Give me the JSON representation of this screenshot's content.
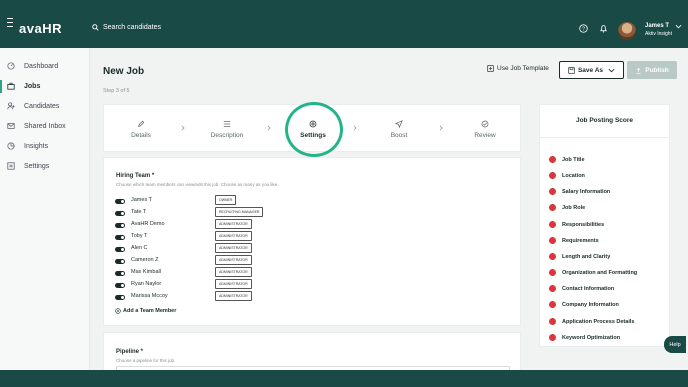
{
  "app": {
    "logo": "avaHR",
    "search_placeholder": "Search candidates",
    "user_name": "James T",
    "user_company": "Aktiv Insight",
    "help_label": "Help"
  },
  "sidebar": {
    "items": [
      {
        "label": "Dashboard",
        "icon": "dashboard-icon"
      },
      {
        "label": "Jobs",
        "icon": "briefcase-icon",
        "active": true
      },
      {
        "label": "Candidates",
        "icon": "users-icon"
      },
      {
        "label": "Shared Inbox",
        "icon": "inbox-icon"
      },
      {
        "label": "Insights",
        "icon": "insights-icon"
      },
      {
        "label": "Settings",
        "icon": "settings-icon"
      }
    ]
  },
  "header": {
    "title": "New Job",
    "step_label": "Step 3 of 5",
    "use_template_label": "Use Job Template",
    "save_as_label": "Save As",
    "publish_label": "Publish"
  },
  "steps": [
    {
      "label": "Details",
      "icon": "pencil-icon"
    },
    {
      "label": "Description",
      "icon": "list-icon"
    },
    {
      "label": "Settings",
      "icon": "gear-icon",
      "active": true
    },
    {
      "label": "Boost",
      "icon": "rocket-icon"
    },
    {
      "label": "Review",
      "icon": "check-circle-icon"
    }
  ],
  "hiring_team": {
    "title": "Hiring Team *",
    "subtitle": "Choose which team members can view/edit this job. Choose as many as you like.",
    "members": [
      {
        "name": "James T",
        "role": "OWNER",
        "enabled": true
      },
      {
        "name": "Tate T",
        "role": "RECRUITING MANAGER",
        "enabled": true
      },
      {
        "name": "AvaHR Demo",
        "role": "ADMINISTRATOR",
        "enabled": true
      },
      {
        "name": "Toby T",
        "role": "ADMINISTRATOR",
        "enabled": true
      },
      {
        "name": "Alen C",
        "role": "ADMINISTRATOR",
        "enabled": true
      },
      {
        "name": "Cameron Z",
        "role": "ADMINISTRATOR",
        "enabled": true
      },
      {
        "name": "Max Kimball",
        "role": "ADMINISTRATOR",
        "enabled": true
      },
      {
        "name": "Ryan Naylor",
        "role": "ADMINISTRATOR",
        "enabled": true
      },
      {
        "name": "Marissa Mccoy",
        "role": "ADMINISTRATOR",
        "enabled": true
      }
    ],
    "add_member_label": "Add a Team Member"
  },
  "pipeline": {
    "title": "Pipeline *",
    "subtitle": "Choose a pipeline for this job."
  },
  "score": {
    "title": "Job Posting Score",
    "status_color": "#d9363e",
    "items": [
      "Job Title",
      "Location",
      "Salary Information",
      "Job Role",
      "Responsibilities",
      "Requirements",
      "Length and Clarity",
      "Organization and Formatting",
      "Contact Information",
      "Company Information",
      "Application Process Details",
      "Keyword Optimization"
    ]
  }
}
